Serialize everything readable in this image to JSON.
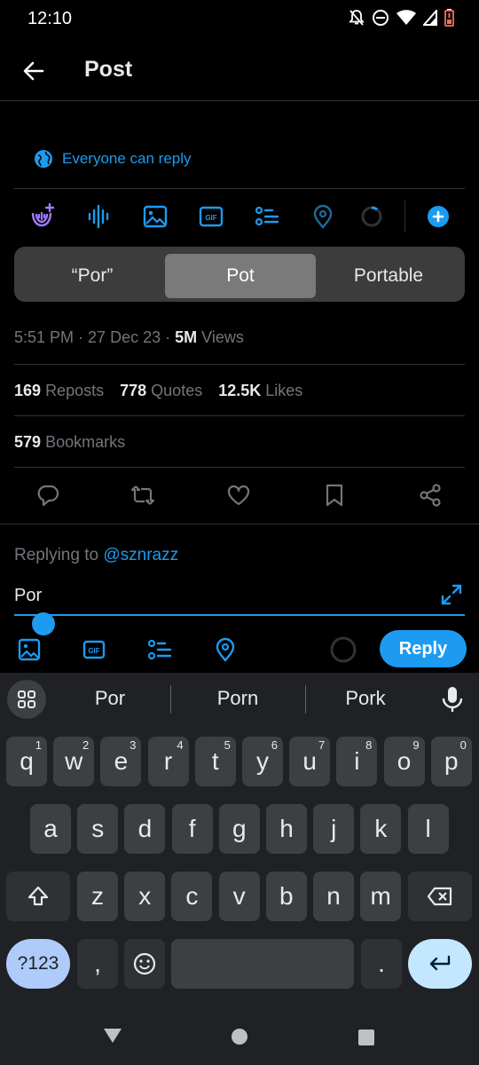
{
  "status_bar": {
    "time": "12:10"
  },
  "header": {
    "title": "Post"
  },
  "reply_permission": {
    "label": "Everyone can reply"
  },
  "suggestions": {
    "items": [
      "“Por”",
      "Pot",
      "Portable"
    ],
    "selected_index": 1
  },
  "tweet_meta": {
    "time": "5:51 PM",
    "date": "27 Dec 23",
    "views_count": "5M",
    "views_label": "Views"
  },
  "stats": {
    "reposts_count": "169",
    "reposts_label": "Reposts",
    "quotes_count": "778",
    "quotes_label": "Quotes",
    "likes_count": "12.5K",
    "likes_label": "Likes",
    "bookmarks_count": "579",
    "bookmarks_label": "Bookmarks"
  },
  "reply": {
    "replying_prefix": "Replying to",
    "replying_handle": "@sznrazz",
    "input_value": "Por",
    "button_label": "Reply"
  },
  "keyboard": {
    "suggestions": [
      "Por",
      "Porn",
      "Pork"
    ],
    "row1": [
      {
        "k": "q",
        "s": "1"
      },
      {
        "k": "w",
        "s": "2"
      },
      {
        "k": "e",
        "s": "3"
      },
      {
        "k": "r",
        "s": "4"
      },
      {
        "k": "t",
        "s": "5"
      },
      {
        "k": "y",
        "s": "6"
      },
      {
        "k": "u",
        "s": "7"
      },
      {
        "k": "i",
        "s": "8"
      },
      {
        "k": "o",
        "s": "9"
      },
      {
        "k": "p",
        "s": "0"
      }
    ],
    "row2": [
      "a",
      "s",
      "d",
      "f",
      "g",
      "h",
      "j",
      "k",
      "l"
    ],
    "row3": [
      "z",
      "x",
      "c",
      "v",
      "b",
      "n",
      "m"
    ],
    "symbols_label": "?123",
    "comma": ",",
    "period": "."
  },
  "colors": {
    "accent": "#1d9bf0",
    "background": "#000000",
    "keyboard_bg": "#202124"
  }
}
